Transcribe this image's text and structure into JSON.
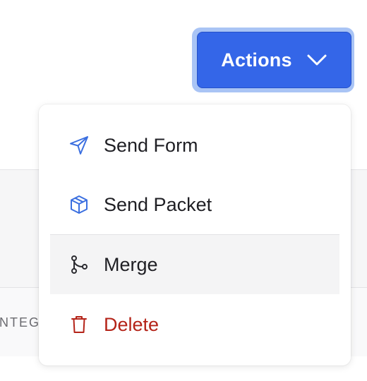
{
  "actions_button": {
    "label": "Actions",
    "chevron_icon": "chevron-down-icon"
  },
  "background": {
    "column_label": "INTEG"
  },
  "menu": {
    "items": [
      {
        "label": "Send Form",
        "icon": "send-icon",
        "state": "normal"
      },
      {
        "label": "Send Packet",
        "icon": "package-icon",
        "state": "normal"
      },
      {
        "label": "Merge",
        "icon": "git-merge-icon",
        "state": "hovered"
      },
      {
        "label": "Delete",
        "icon": "trash-icon",
        "state": "danger"
      }
    ]
  },
  "colors": {
    "accent": "#3466e8",
    "accent_ring": "#a9c4f5",
    "icon_blue": "#3b6fe0",
    "danger": "#b42318",
    "hover_bg": "#f4f4f5"
  }
}
